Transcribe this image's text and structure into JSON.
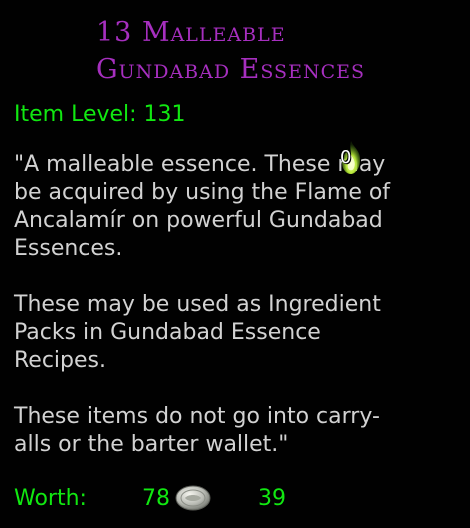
{
  "tooltip": {
    "title_line1": "13 Malleable",
    "title_line2": "Gundabad Essences",
    "item_level": "Item Level: 131",
    "stack_count": "0",
    "description": {
      "p1_l1": "\"A malleable essence. These may",
      "p1_l2": "be acquired by using the Flame of",
      "p1_l3": "Ancalamír on powerful Gundabad",
      "p1_l4": "Essences.",
      "p2_l1": "These may be used as Ingredient",
      "p2_l2": "Packs in Gundabad Essence",
      "p2_l3": "Recipes.",
      "p3_l1": "These items do not go into carry-",
      "p3_l2": "alls or the barter wallet.\""
    },
    "worth": {
      "label": "Worth:",
      "silver": "78",
      "copper": "39",
      "coin_icon": "silver-coin-icon"
    },
    "flame_icon": "flame-icon",
    "colors": {
      "title": "#a62fbf",
      "green": "#11e811",
      "text": "#d2d2d2",
      "background": "#010101"
    }
  }
}
